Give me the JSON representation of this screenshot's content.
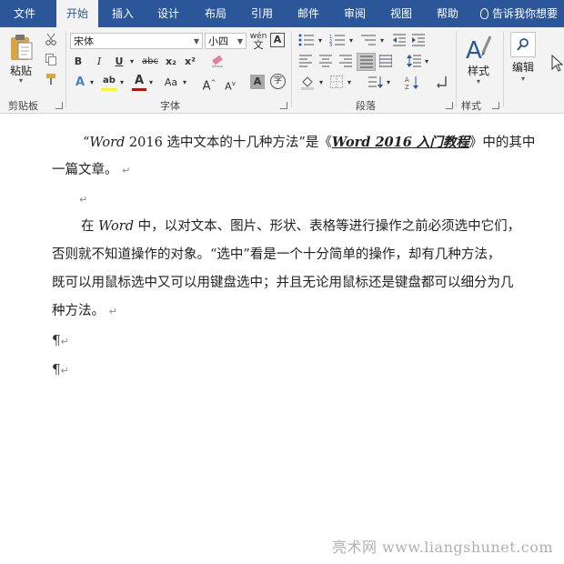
{
  "menu": {
    "tabs": [
      {
        "label": "文件"
      },
      {
        "label": "开始"
      },
      {
        "label": "插入"
      },
      {
        "label": "设计"
      },
      {
        "label": "布局"
      },
      {
        "label": "引用"
      },
      {
        "label": "邮件"
      },
      {
        "label": "审阅"
      },
      {
        "label": "视图"
      },
      {
        "label": "帮助"
      }
    ],
    "active_tab": "开始",
    "tell_me": "告诉我你想要"
  },
  "ribbon": {
    "clipboard": {
      "group_label": "剪贴板",
      "paste_label": "粘贴"
    },
    "font": {
      "group_label": "字体",
      "font_name": "宋体",
      "font_size": "小四",
      "phonetic": "wén",
      "border_char": "A",
      "bold": "B",
      "italic": "I",
      "underline": "U",
      "strike": "abc",
      "sub": "x₂",
      "sup": "x²",
      "effects": "A",
      "highlight": "ab",
      "color": "A",
      "change_case": "Aa",
      "grow": "A",
      "shrink": "A",
      "shading": "A",
      "enclose": "字",
      "highlight_color": "#ffff00",
      "font_color": "#e00000"
    },
    "paragraph": {
      "group_label": "段落"
    },
    "styles": {
      "group_label": "样式",
      "styles_label": "样式"
    },
    "editing": {
      "editing_label": "编辑"
    }
  },
  "document": {
    "para1_line1_open": "“",
    "para1_word": "Word",
    "para1_line1_mid": " 2016 选中文本的十几种方法”是《",
    "para1_book": "Word 2016 入门教程",
    "para1_line1_end": "》中的其中",
    "para1_line2": "一篇文章。",
    "para2_line1_a": "在 ",
    "para2_word": "Word",
    "para2_line1_b": " 中，以对文本、图片、形状、表格等进行操作之前必须选中它们，",
    "para2_line2": "否则就不知道操作的对象。“选中”看是一个十分简单的操作，却有几种方法，",
    "para2_line3": "既可以用鼠标选中又可以用键盘选中；并且无论用鼠标还是键盘都可以细分为几",
    "para2_line4": "种方法。",
    "return_mark": "↵",
    "pilcrow": "¶"
  },
  "watermark": "亮术网 www.liangshunet.com"
}
